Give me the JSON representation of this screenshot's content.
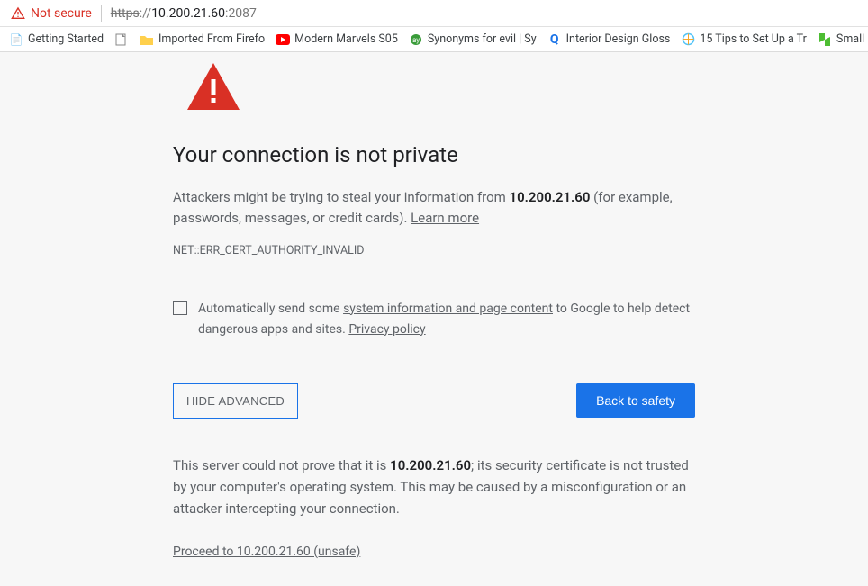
{
  "address": {
    "security_label": "Not secure",
    "protocol_struck": "https",
    "punct1": "://",
    "host": "10.200.21.60",
    "port": ":2087"
  },
  "bookmarks": [
    {
      "label": "Getting Started",
      "icon": "page"
    },
    {
      "label": "",
      "icon": "page-blank"
    },
    {
      "label": "Imported From Firefo",
      "icon": "folder"
    },
    {
      "label": "Modern Marvels S05",
      "icon": "youtube"
    },
    {
      "label": "Synonyms for evil | Sy",
      "icon": "green-dot"
    },
    {
      "label": "Interior Design Gloss",
      "icon": "q"
    },
    {
      "label": "15 Tips to Set Up a Tr",
      "icon": "globe"
    },
    {
      "label": "Small Bathro",
      "icon": "houzz"
    }
  ],
  "page": {
    "heading": "Your connection is not private",
    "body_pre": "Attackers might be trying to steal your information from ",
    "body_host": "10.200.21.60",
    "body_post": " (for example, passwords, messages, or credit cards). ",
    "learn_more": "Learn more",
    "error_code": "NET::ERR_CERT_AUTHORITY_INVALID",
    "report_pre": "Automatically send some ",
    "report_link1": "system information and page content",
    "report_mid": " to Google to help detect dangerous apps and sites. ",
    "report_link2": "Privacy policy",
    "hide_advanced": "HIDE ADVANCED",
    "back_to_safety": "Back to safety",
    "adv_pre": "This server could not prove that it is ",
    "adv_host": "10.200.21.60",
    "adv_post": "; its security certificate is not trusted by your computer's operating system. This may be caused by a misconfiguration or an attacker intercepting your connection.",
    "proceed": "Proceed to 10.200.21.60 (unsafe)"
  }
}
